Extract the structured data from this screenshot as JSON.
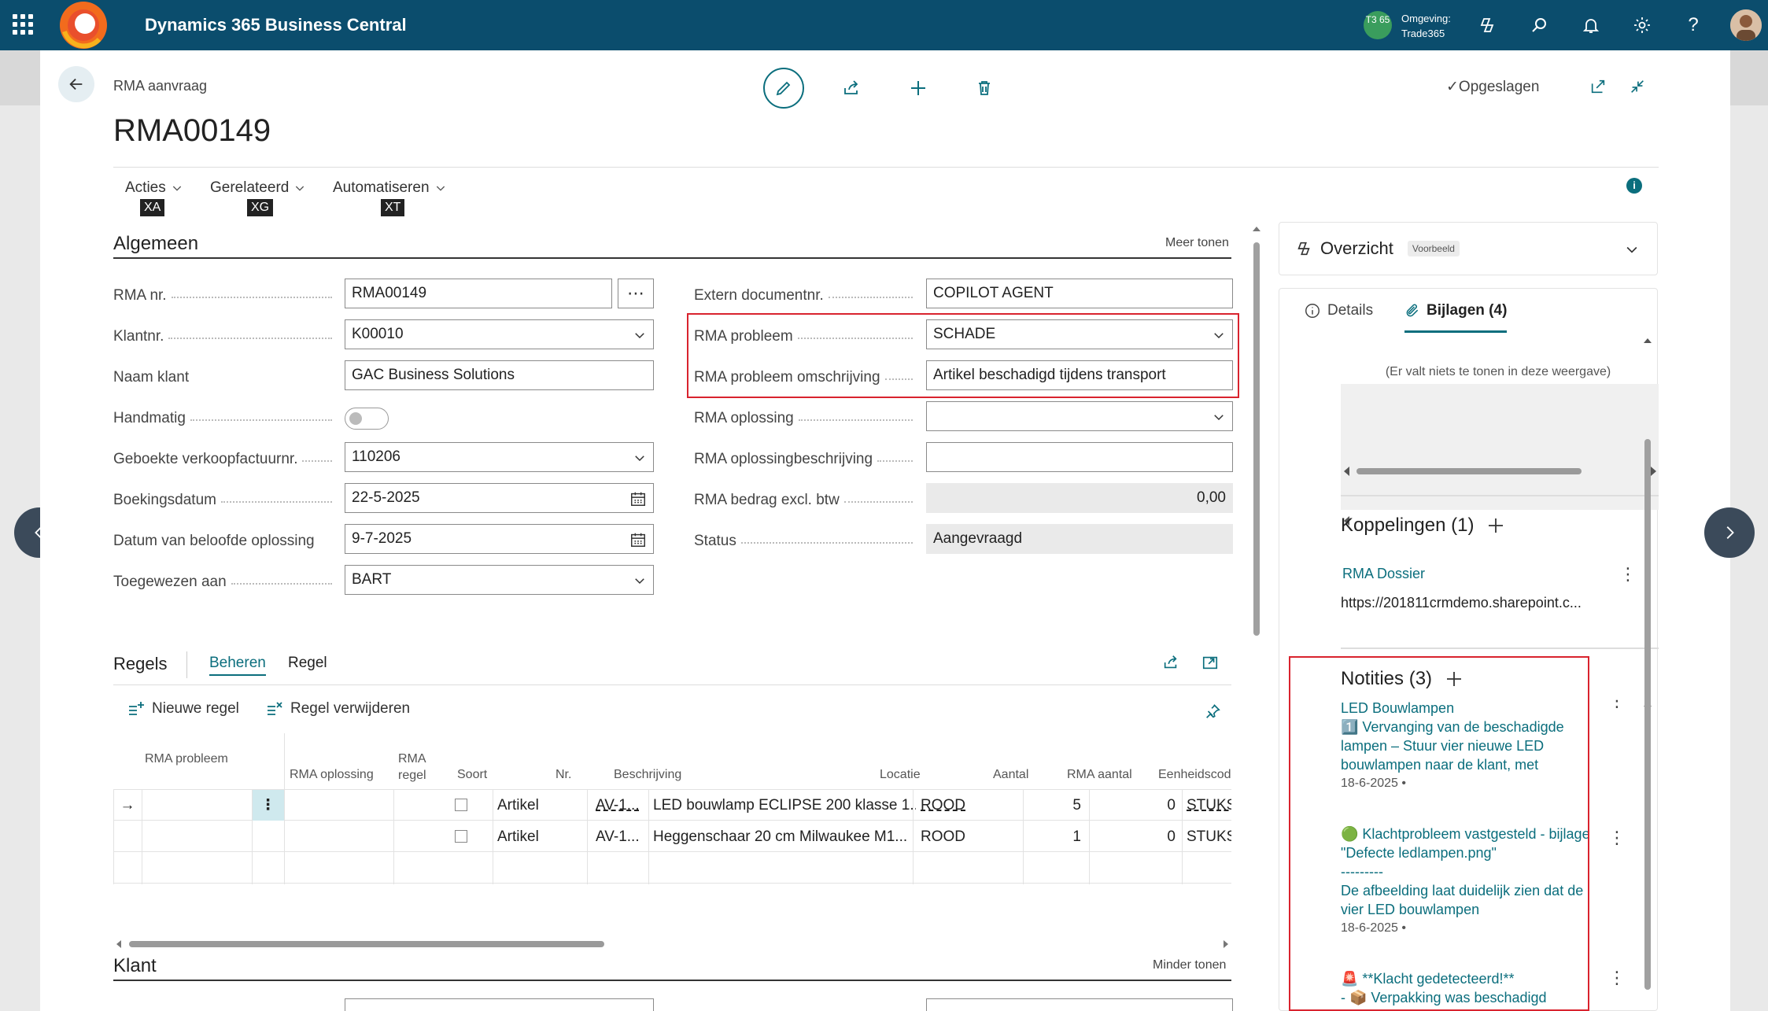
{
  "app": {
    "title": "Dynamics 365 Business Central",
    "env_badge": "T3 65",
    "env_label": "Omgeving:",
    "env_name": "Trade365",
    "accent": "#0b4d6d",
    "teal": "#0b6e7d"
  },
  "header": {
    "breadcrumb": "RMA aanvraag",
    "title": "RMA00149",
    "saved_label": "Opgeslagen",
    "menu": [
      {
        "label": "Acties",
        "keytip": "XA"
      },
      {
        "label": "Gerelateerd",
        "keytip": "XG"
      },
      {
        "label": "Automatiseren",
        "keytip": "XT"
      }
    ]
  },
  "general": {
    "title": "Algemeen",
    "toggle_link": "Meer tonen",
    "left_fields": [
      {
        "label": "RMA nr.",
        "value": "RMA00149"
      },
      {
        "label": "Klantnr.",
        "value": "K00010"
      },
      {
        "label": "Naam klant",
        "value": "GAC Business Solutions"
      },
      {
        "label": "Handmatig",
        "value": "off"
      },
      {
        "label": "Geboekte verkoopfactuurnr.",
        "value": "110206"
      },
      {
        "label": "Boekingsdatum",
        "value": "22-5-2025"
      },
      {
        "label": "Datum van beloofde oplossing",
        "value": "9-7-2025"
      },
      {
        "label": "Toegewezen aan",
        "value": "BART"
      }
    ],
    "right_fields": [
      {
        "label": "Extern documentnr.",
        "value": "COPILOT AGENT"
      },
      {
        "label": "RMA probleem",
        "value": "SCHADE"
      },
      {
        "label": "RMA probleem omschrijving",
        "value": "Artikel beschadigd tijdens transport"
      },
      {
        "label": "RMA oplossing",
        "value": ""
      },
      {
        "label": "RMA oplossingbeschrijving",
        "value": ""
      },
      {
        "label": "RMA bedrag excl. btw",
        "value": "0,00"
      },
      {
        "label": "Status",
        "value": "Aangevraagd"
      }
    ]
  },
  "lines": {
    "title": "Regels",
    "tabs": [
      "Beheren",
      "Regel"
    ],
    "new_line": "Nieuwe regel",
    "delete_line": "Regel verwijderen",
    "columns": [
      "RMA probleem",
      "RMA oplossing",
      "RMA regel",
      "Soort",
      "Nr.",
      "Beschrijving",
      "Locatie",
      "Aantal",
      "RMA aantal",
      "Eenheidscod"
    ],
    "rows": [
      {
        "soort": "Artikel",
        "nr": "AV-1...",
        "beschrijving": "LED bouwlamp ECLIPSE 200 klasse 1...",
        "locatie": "ROOD",
        "aantal": "5",
        "rma_aantal": "0",
        "eenheid": "STUKS"
      },
      {
        "soort": "Artikel",
        "nr": "AV-1...",
        "beschrijving": "Heggenschaar 20 cm Milwaukee M1...",
        "locatie": "ROOD",
        "aantal": "1",
        "rma_aantal": "0",
        "eenheid": "STUKS"
      }
    ]
  },
  "customer": {
    "title": "Klant",
    "toggle_link": "Minder tonen"
  },
  "factbox": {
    "overview_title": "Overzicht",
    "preview_badge": "Voorbeeld",
    "tab_details": "Details",
    "tab_attachments": "Bijlagen (4)",
    "empty_text": "(Er valt niets te tonen in deze weergave)",
    "links_title": "Koppelingen (1)",
    "link_name": "RMA Dossier",
    "link_url": "https://201811crmdemo.sharepoint.c...",
    "notes_title": "Notities (3)",
    "notes": [
      {
        "lines": [
          "LED Bouwlampen",
          "1️⃣ Vervanging van de beschadigde lampen – Stuur vier nieuwe LED bouwlampen naar de klant, met"
        ],
        "date": "18-6-2025 •"
      },
      {
        "lines": [
          "🟢 Klachtprobleem vastgesteld - bijlage \"Defecte ledlampen.png\"",
          "---------",
          "De afbeelding laat duidelijk zien dat de vier LED bouwlampen"
        ],
        "date": "18-6-2025 •"
      },
      {
        "lines": [
          "🚨 **Klacht gedetecteerd!**",
          "- 📦 Verpakking was beschadigd"
        ],
        "date": ""
      }
    ]
  }
}
